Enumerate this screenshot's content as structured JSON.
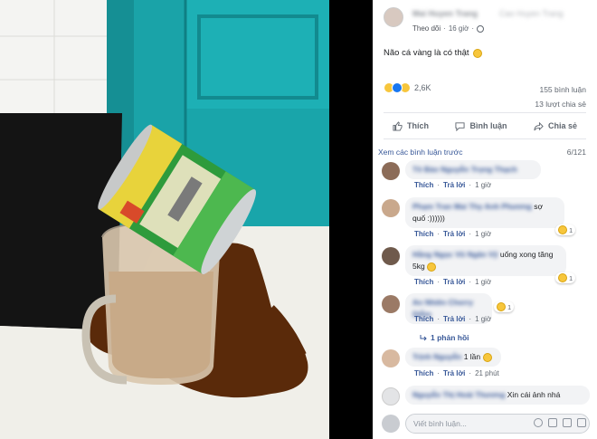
{
  "post": {
    "author": "Mai Huyen Trang",
    "author_extra": "Cao Huyen Trang",
    "follow": "Theo dõi",
    "time": "16 giờ",
    "text": "Não cá vàng là có thật",
    "reaction_count": "2,6K",
    "comments_count": "155 bình luận",
    "shares_count": "13 lượt chia sẻ"
  },
  "actions": {
    "like": "Thích",
    "comment": "Bình luận",
    "share": "Chia sẻ"
  },
  "comments_header": {
    "previous": "Xem các bình luận trước",
    "pager": "6/121"
  },
  "comments": [
    {
      "name": "Tô Bảo Nguyễn Trọng Thạch",
      "text": "",
      "like": "Thích",
      "reply": "Trả lời",
      "time": "1 giờ"
    },
    {
      "name": "Phạm Tran Mai Thy Anh Phương",
      "text": "sợ quố :))))))",
      "like": "Thích",
      "reply": "Trả lời",
      "time": "1 giờ",
      "badge": "1"
    },
    {
      "name": "Hằng Ngọc Vũ Ngân Vỹ",
      "text": "uống xong tăng 5kg",
      "like": "Thích",
      "reply": "Trả lời",
      "time": "1 giờ",
      "badge": "1"
    },
    {
      "name": "An Nhiên Cherry Diễm",
      "text": "",
      "like": "Thích",
      "reply": "Trả lời",
      "time": "1 giờ",
      "badge": "1",
      "replies": "1 phản hồi"
    },
    {
      "name": "Trịnh Nguyễn",
      "text": "1 lần",
      "like": "Thích",
      "reply": "Trả lời",
      "time": "21 phút"
    },
    {
      "name": "Nguyễn Thị Hoài Thương",
      "text": "Xin cái ảnh nhá",
      "like": "",
      "reply": "",
      "time": ""
    }
  ],
  "composer": {
    "placeholder": "Viết bình luận..."
  },
  "colors": {
    "link": "#385898",
    "teal": "#1aa3a8",
    "coffee": "#5a2a0a",
    "can_green": "#2e9b3c"
  }
}
